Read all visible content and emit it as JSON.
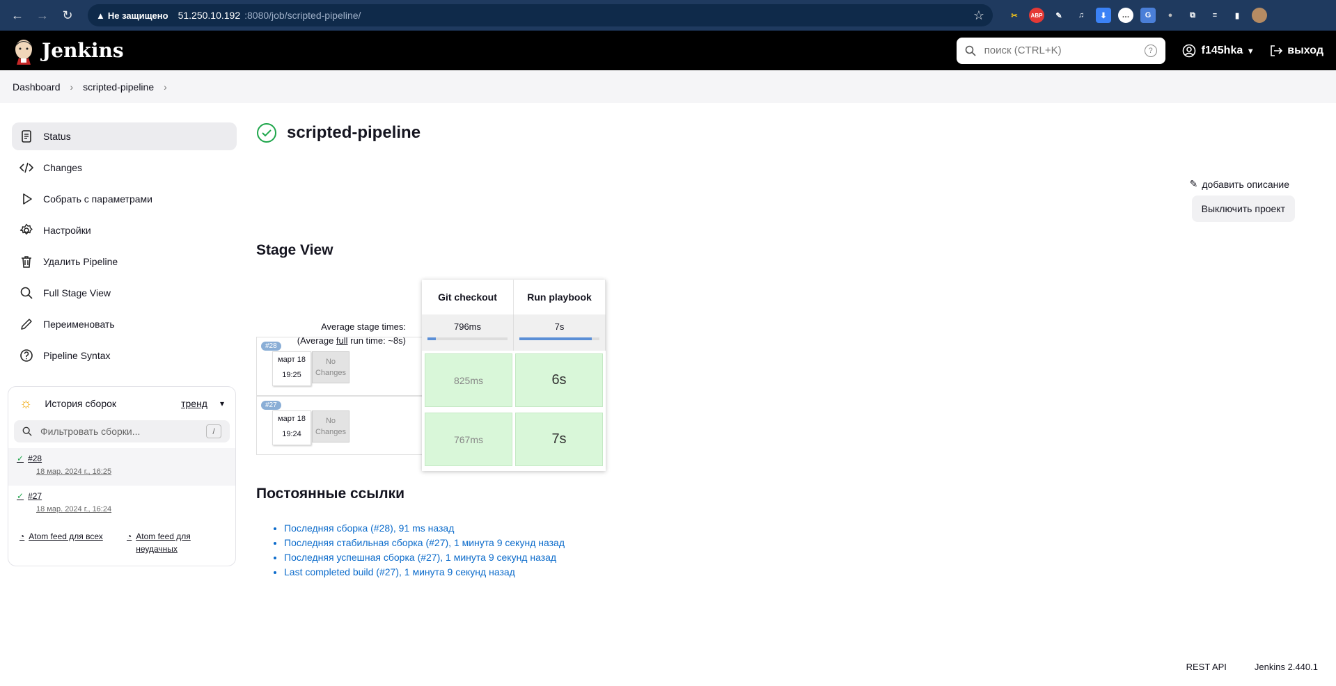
{
  "browser": {
    "security_label": "Не защищено",
    "url_host": "51.250.10.192",
    "url_path": ":8080/job/scripted-pipeline/"
  },
  "header": {
    "app_title": "Jenkins",
    "search_placeholder": "поиск (CTRL+K)",
    "user": "f145hka",
    "logout": "выход"
  },
  "breadcrumb": [
    "Dashboard",
    "scripted-pipeline"
  ],
  "sidebar": {
    "items": [
      {
        "label": "Status",
        "icon": "document-icon"
      },
      {
        "label": "Changes",
        "icon": "code-icon"
      },
      {
        "label": "Собрать с параметрами",
        "icon": "play-icon"
      },
      {
        "label": "Настройки",
        "icon": "gear-icon"
      },
      {
        "label": "Удалить Pipeline",
        "icon": "trash-icon"
      },
      {
        "label": "Full Stage View",
        "icon": "search-icon"
      },
      {
        "label": "Переименовать",
        "icon": "pencil-icon"
      },
      {
        "label": "Pipeline Syntax",
        "icon": "help-icon"
      }
    ]
  },
  "history": {
    "title": "История сборок",
    "trend": "тренд",
    "filter_placeholder": "Фильтровать сборки...",
    "filter_key": "/",
    "builds": [
      {
        "number": "#28",
        "date": "18 мар. 2024 г., 16:25"
      },
      {
        "number": "#27",
        "date": "18 мар. 2024 г., 16:24"
      }
    ],
    "feed_all": "Atom feed для всех",
    "feed_failed": "Atom feed для неудачных"
  },
  "main": {
    "title": "scripted-pipeline",
    "add_description": "добавить описание",
    "disable_project": "Выключить проект",
    "stage_view_title": "Stage View",
    "avg_line1": "Average stage times:",
    "avg_line2_pre": "(Average ",
    "avg_line2_full": "full",
    "avg_line2_post": " run time: ~8s)",
    "stages": [
      {
        "name": "Git checkout",
        "avg": "796ms",
        "avg_fraction": 0.1
      },
      {
        "name": "Run playbook",
        "avg": "7s",
        "avg_fraction": 0.9
      }
    ],
    "runs": [
      {
        "badge": "#28",
        "date": "март 18",
        "time": "19:25",
        "changes": "No Changes",
        "times": [
          "825ms",
          "6s"
        ]
      },
      {
        "badge": "#27",
        "date": "март 18",
        "time": "19:24",
        "changes": "No Changes",
        "times": [
          "767ms",
          "7s"
        ]
      }
    ],
    "permalinks_title": "Постоянные ссылки",
    "permalinks": [
      "Последняя сборка (#28), 91 ms назад",
      "Последняя стабильная сборка (#27), 1 минута 9 секунд назад",
      "Последняя успешная сборка (#27), 1 минута 9 секунд назад",
      "Last completed build (#27), 1 минута 9 секунд назад"
    ]
  },
  "footer": {
    "rest_api": "REST API",
    "version": "Jenkins 2.440.1"
  },
  "colors": {
    "success": "#1ea64b",
    "link": "#0b6bcb",
    "stage_ok": "#d9f7d9"
  }
}
